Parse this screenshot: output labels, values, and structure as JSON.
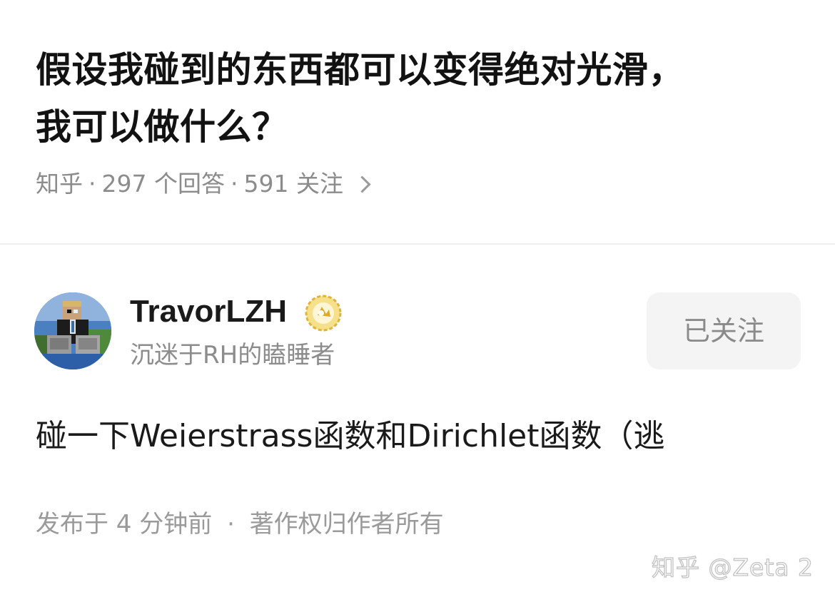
{
  "question": {
    "title_line1": "假设我碰到的东西都可以变得绝对光滑，",
    "title_line2": "我可以做什么？",
    "meta": {
      "source": "知乎",
      "separator": "·",
      "answers": "297 个回答",
      "followers": "591 关注"
    }
  },
  "author": {
    "name": "TravorLZH",
    "bio": "沉迷于RH的瞌睡者",
    "follow_label": "已关注"
  },
  "answer": {
    "text": "碰一下Weierstrass函数和Dirichlet函数（逃",
    "footer": {
      "published": "发布于 4 分钟前",
      "separator": "·",
      "copyright": "著作权归作者所有"
    }
  },
  "watermark": "知乎 @Zeta 2",
  "colors": {
    "title": "#121212",
    "secondary_text": "#8c8c8c",
    "button_bg": "#f4f4f4",
    "divider": "#efefef",
    "badge_gold": "#e8c24a"
  },
  "icons": {
    "meta_chevron": "chevron-right-icon",
    "badge": "gold-badge-icon"
  }
}
